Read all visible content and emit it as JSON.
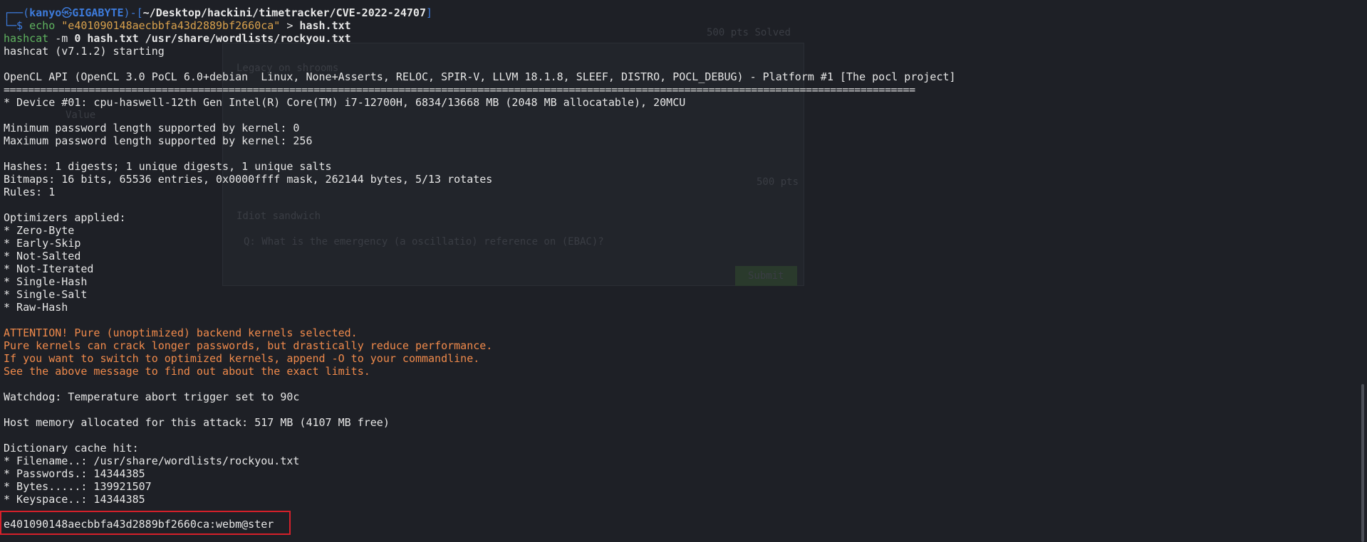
{
  "prompt": {
    "frame_top": "┌──(",
    "user": "kanyo",
    "at": "㉿",
    "host": "GIGABYTE",
    "mid": ")-[",
    "path": "~/Desktop/hackini/timetracker/CVE-2022-24707",
    "end": "]",
    "frame_bottom": "└─$ "
  },
  "commands": {
    "echo_cmd": "echo",
    "echo_str": "\"e401090148aecbbfa43d2889bf2660ca\"",
    "echo_op": " > ",
    "echo_file": "hash.txt",
    "hashcat_cmd": "hashcat",
    "hashcat_flag": " -m ",
    "hashcat_mode": "0",
    "hashcat_args": " hash.txt /usr/share/wordlists/rockyou.txt"
  },
  "output": {
    "starting": "hashcat (v7.1.2) starting",
    "opencl": "OpenCL API (OpenCL 3.0 PoCL 6.0+debian  Linux, None+Asserts, RELOC, SPIR-V, LLVM 18.1.8, SLEEF, DISTRO, POCL_DEBUG) - Platform #1 [The pocl project]",
    "separator": "======================================================================================================================================================",
    "device": "* Device #01: cpu-haswell-12th Gen Intel(R) Core(TM) i7-12700H, 6834/13668 MB (2048 MB allocatable), 20MCU",
    "min_pw": "Minimum password length supported by kernel: 0",
    "max_pw": "Maximum password length supported by kernel: 256",
    "hashes": "Hashes: 1 digests; 1 unique digests, 1 unique salts",
    "bitmaps": "Bitmaps: 16 bits, 65536 entries, 0x0000ffff mask, 262144 bytes, 5/13 rotates",
    "rules": "Rules: 1",
    "optimizers_title": "Optimizers applied:",
    "optimizers": [
      "* Zero-Byte",
      "* Early-Skip",
      "* Not-Salted",
      "* Not-Iterated",
      "* Single-Hash",
      "* Single-Salt",
      "* Raw-Hash"
    ],
    "warnings": [
      "ATTENTION! Pure (unoptimized) backend kernels selected.",
      "Pure kernels can crack longer passwords, but drastically reduce performance.",
      "If you want to switch to optimized kernels, append -O to your commandline.",
      "See the above message to find out about the exact limits."
    ],
    "watchdog": "Watchdog: Temperature abort trigger set to 90c",
    "host_mem": "Host memory allocated for this attack: 517 MB (4107 MB free)",
    "dict_title": "Dictionary cache hit:",
    "dict": [
      "* Filename..: /usr/share/wordlists/rockyou.txt",
      "* Passwords.: 14344385",
      "* Bytes.....: 139921507",
      "* Keyspace..: 14344385"
    ],
    "result": "e401090148aecbbfa43d2889bf2660ca:webm@ster"
  },
  "background": {
    "ghost_title1": "Legacy on shrooms",
    "ghost_title2": "Idiot sandwich",
    "ghost_pts1": "500 pts",
    "ghost_solved": "Solved",
    "ghost_pts2": "500 pts",
    "ghost_question": "Q: What is the emergency (a oscillatio) reference on (EBAC)?",
    "ghost_submit": "Submit",
    "ghost_value": "Value"
  },
  "colors": {
    "background": "#1e2026",
    "prompt_blue": "#3d7bdb",
    "command_green": "#5fb35f",
    "string_yellow": "#d9a14c",
    "warning_orange": "#f08a4b",
    "highlight_red": "#d6202a"
  }
}
